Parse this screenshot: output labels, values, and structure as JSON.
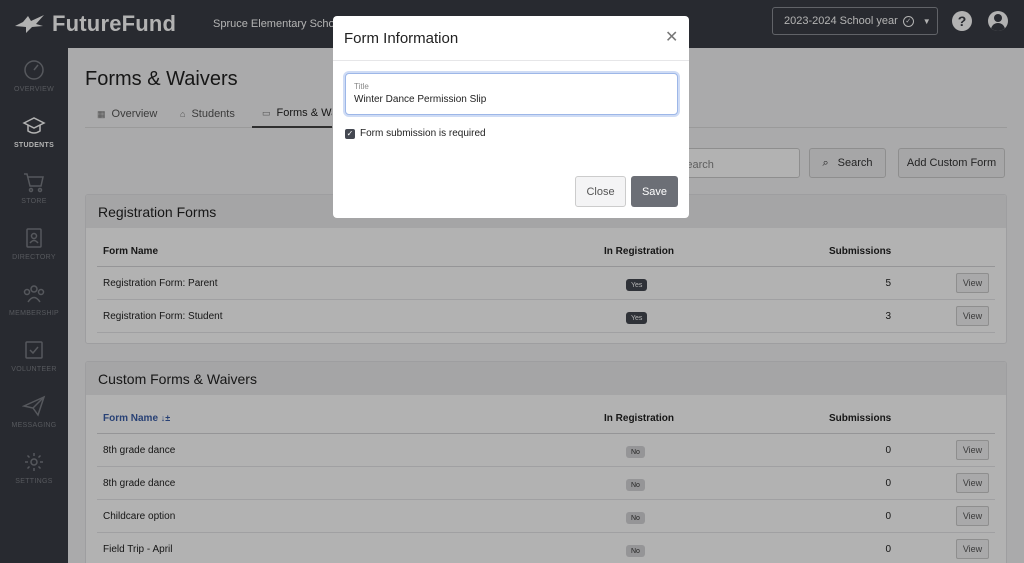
{
  "app": {
    "name": "FutureFund",
    "school": "Spruce Elementary School",
    "year": "2023-2024 School year"
  },
  "sidebar": {
    "items": [
      {
        "label": "OVERVIEW",
        "icon": "gauge-icon"
      },
      {
        "label": "STUDENTS",
        "icon": "graduation-cap-icon"
      },
      {
        "label": "STORE",
        "icon": "cart-icon"
      },
      {
        "label": "DIRECTORY",
        "icon": "contact-book-icon"
      },
      {
        "label": "MEMBERSHIP",
        "icon": "people-icon"
      },
      {
        "label": "VOLUNTEER",
        "icon": "checkbox-icon"
      },
      {
        "label": "MESSAGING",
        "icon": "paper-plane-icon"
      },
      {
        "label": "SETTINGS",
        "icon": "gear-icon"
      }
    ]
  },
  "page": {
    "title": "Forms & Waivers",
    "tabs": [
      {
        "label": "Overview"
      },
      {
        "label": "Students"
      },
      {
        "label": "Forms & Waivers"
      }
    ],
    "search_placeholder": "Search",
    "search_button": "Search",
    "add_button": "Add Custom Form"
  },
  "registration": {
    "title": "Registration Forms",
    "columns": {
      "name": "Form Name",
      "in_reg": "In Registration",
      "subs": "Submissions"
    },
    "rows": [
      {
        "name": "Registration Form: Parent",
        "in_reg": "Yes",
        "subs": "5",
        "action": "View"
      },
      {
        "name": "Registration Form: Student",
        "in_reg": "Yes",
        "subs": "3",
        "action": "View"
      }
    ]
  },
  "custom": {
    "title": "Custom Forms & Waivers",
    "columns": {
      "name": "Form Name",
      "sort": "↓±",
      "in_reg": "In Registration",
      "subs": "Submissions"
    },
    "rows": [
      {
        "name": "8th grade dance",
        "in_reg": "No",
        "subs": "0",
        "action": "View"
      },
      {
        "name": "8th grade dance",
        "in_reg": "No",
        "subs": "0",
        "action": "View"
      },
      {
        "name": "Childcare option",
        "in_reg": "No",
        "subs": "0",
        "action": "View"
      },
      {
        "name": "Field Trip - April",
        "in_reg": "No",
        "subs": "0",
        "action": "View"
      }
    ]
  },
  "modal": {
    "title": "Form Information",
    "field_label": "Title",
    "field_value": "Winter Dance Permission Slip",
    "checkbox_label": "Form submission is required",
    "close_label": "Close",
    "save_label": "Save"
  }
}
